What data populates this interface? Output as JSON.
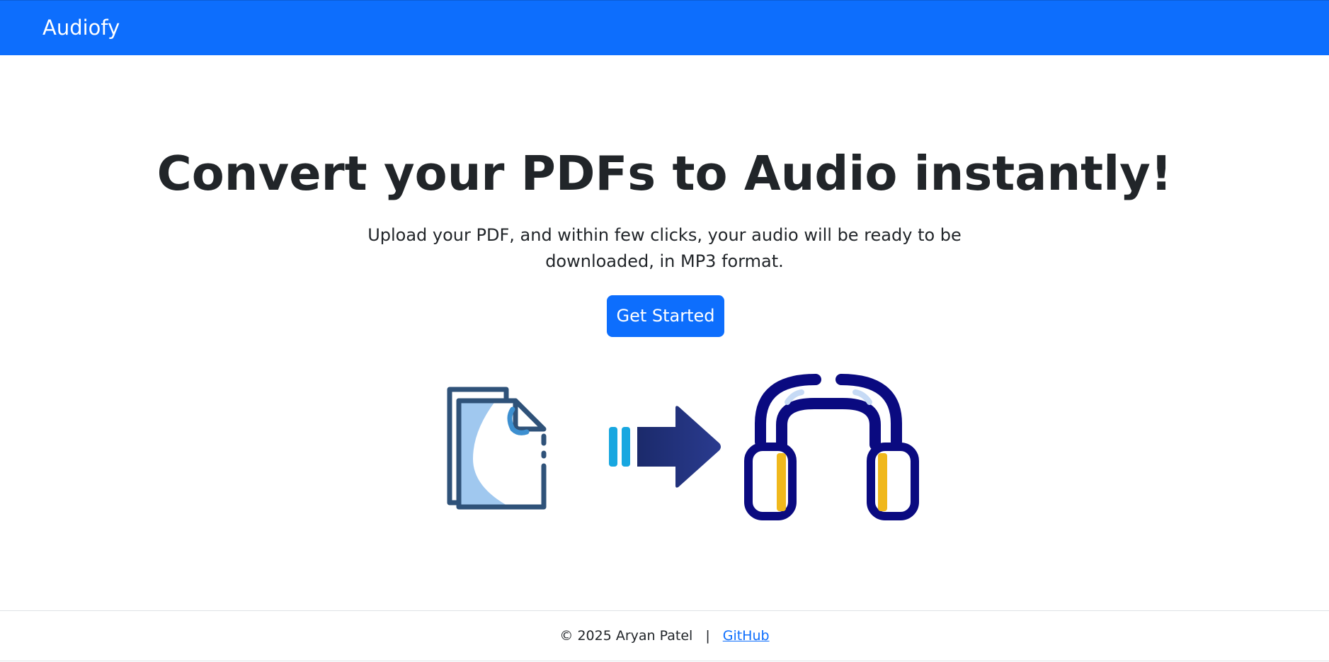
{
  "navbar": {
    "brand": "Audiofy",
    "color": "#0d6efd"
  },
  "hero": {
    "title": "Convert your PDFs to Audio instantly!",
    "lead": "Upload your PDF, and within few clicks, your audio will be ready to be downloaded, in MP3 format.",
    "cta_label": "Get Started"
  },
  "illustration": {
    "icons": [
      "pdf-document-icon",
      "arrow-right-icon",
      "headphones-icon"
    ]
  },
  "footer": {
    "copyright": "© 2025 Aryan Patel",
    "separator": "|",
    "link_label": "GitHub"
  }
}
